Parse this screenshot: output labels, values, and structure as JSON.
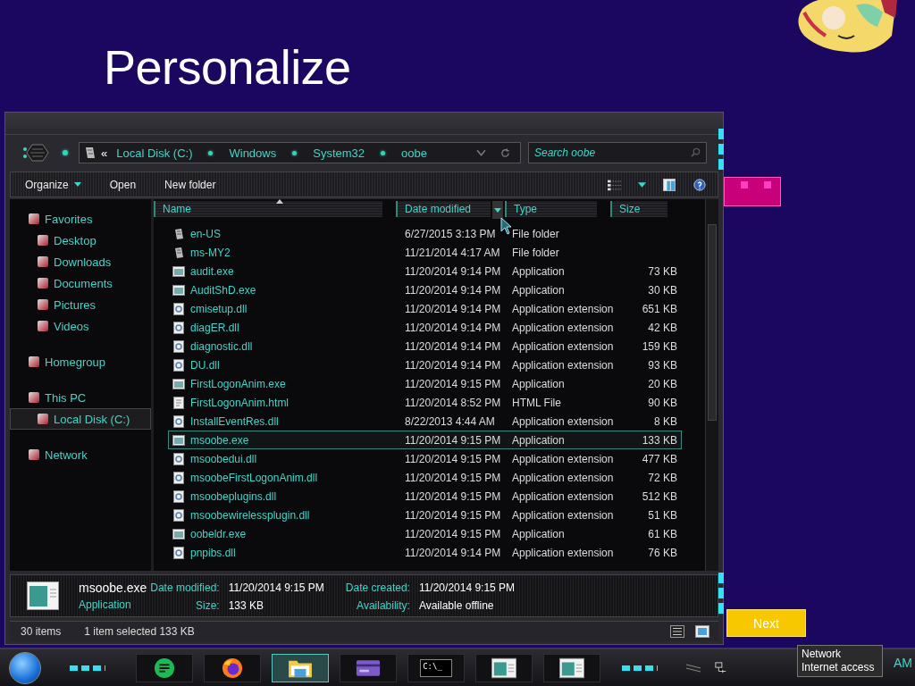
{
  "page": {
    "title": "Personalize"
  },
  "explorer": {
    "address": {
      "prefix": "«",
      "crumbs": [
        "Local Disk (C:)",
        "Windows",
        "System32",
        "oobe"
      ]
    },
    "search": {
      "placeholder": "Search oobe"
    },
    "toolbar": [
      {
        "label": "Organize",
        "kind": "menu"
      },
      {
        "label": "Open",
        "kind": "plain"
      },
      {
        "label": "New folder",
        "kind": "plain"
      }
    ],
    "sidebar": {
      "items": [
        {
          "label": "Favorites",
          "selected": false,
          "children": [
            {
              "label": "Desktop",
              "selected": false
            },
            {
              "label": "Downloads",
              "selected": false
            },
            {
              "label": "Documents",
              "selected": false
            },
            {
              "label": "Pictures",
              "selected": false
            },
            {
              "label": "Videos",
              "selected": false
            }
          ]
        },
        {
          "label": "Homegroup",
          "selected": false
        },
        {
          "label": "This PC",
          "selected": false,
          "children": [
            {
              "label": "Local Disk (C:)",
              "selected": true
            }
          ]
        },
        {
          "label": "Network",
          "selected": false
        }
      ]
    },
    "table": {
      "columns": [
        "Name",
        "Date modified",
        "Type",
        "Size"
      ],
      "rows": [
        {
          "kind": "folder",
          "name": "en-US",
          "date": "6/27/2015 3:13 PM",
          "type": "File folder",
          "size": "",
          "selected": false
        },
        {
          "kind": "folder",
          "name": "ms-MY2",
          "date": "11/21/2014 4:17 AM",
          "type": "File folder",
          "size": "",
          "selected": false
        },
        {
          "kind": "app",
          "name": "audit.exe",
          "date": "11/20/2014 9:14 PM",
          "type": "Application",
          "size": "73 KB",
          "selected": false
        },
        {
          "kind": "app",
          "name": "AuditShD.exe",
          "date": "11/20/2014 9:14 PM",
          "type": "Application",
          "size": "30 KB",
          "selected": false
        },
        {
          "kind": "dll",
          "name": "cmisetup.dll",
          "date": "11/20/2014 9:14 PM",
          "type": "Application extension",
          "size": "651 KB",
          "selected": false
        },
        {
          "kind": "dll",
          "name": "diagER.dll",
          "date": "11/20/2014 9:14 PM",
          "type": "Application extension",
          "size": "42 KB",
          "selected": false
        },
        {
          "kind": "dll",
          "name": "diagnostic.dll",
          "date": "11/20/2014 9:14 PM",
          "type": "Application extension",
          "size": "159 KB",
          "selected": false
        },
        {
          "kind": "dll",
          "name": "DU.dll",
          "date": "11/20/2014 9:14 PM",
          "type": "Application extension",
          "size": "93 KB",
          "selected": false
        },
        {
          "kind": "app",
          "name": "FirstLogonAnim.exe",
          "date": "11/20/2014 9:15 PM",
          "type": "Application",
          "size": "20 KB",
          "selected": false
        },
        {
          "kind": "html",
          "name": "FirstLogonAnim.html",
          "date": "11/20/2014 8:52 PM",
          "type": "HTML File",
          "size": "90 KB",
          "selected": false
        },
        {
          "kind": "dll",
          "name": "InstallEventRes.dll",
          "date": "8/22/2013 4:44 AM",
          "type": "Application extension",
          "size": "8 KB",
          "selected": false
        },
        {
          "kind": "app",
          "name": "msoobe.exe",
          "date": "11/20/2014 9:15 PM",
          "type": "Application",
          "size": "133 KB",
          "selected": true
        },
        {
          "kind": "dll",
          "name": "msoobedui.dll",
          "date": "11/20/2014 9:15 PM",
          "type": "Application extension",
          "size": "477 KB",
          "selected": false
        },
        {
          "kind": "dll",
          "name": "msoobeFirstLogonAnim.dll",
          "date": "11/20/2014 9:15 PM",
          "type": "Application extension",
          "size": "72 KB",
          "selected": false
        },
        {
          "kind": "dll",
          "name": "msoobeplugins.dll",
          "date": "11/20/2014 9:15 PM",
          "type": "Application extension",
          "size": "512 KB",
          "selected": false
        },
        {
          "kind": "dll",
          "name": "msoobewirelessplugin.dll",
          "date": "11/20/2014 9:15 PM",
          "type": "Application extension",
          "size": "51 KB",
          "selected": false
        },
        {
          "kind": "app",
          "name": "oobeldr.exe",
          "date": "11/20/2014 9:15 PM",
          "type": "Application",
          "size": "61 KB",
          "selected": false
        },
        {
          "kind": "dll",
          "name": "pnpibs.dll",
          "date": "11/20/2014 9:14 PM",
          "type": "Application extension",
          "size": "76 KB",
          "selected": false
        }
      ]
    },
    "details": {
      "name": "msoobe.exe",
      "type": "Application",
      "fields": [
        {
          "label": "Date modified:",
          "value": "11/20/2014 9:15 PM"
        },
        {
          "label": "Date created:",
          "value": "11/20/2014 9:15 PM"
        },
        {
          "label": "Size:",
          "value": "133 KB"
        },
        {
          "label": "Availability:",
          "value": "Available offline"
        }
      ]
    },
    "status_bar": {
      "count": "30 items",
      "selection": "1 item selected  133 KB"
    }
  },
  "next_button": {
    "label": "Next"
  },
  "taskbar": {
    "items": [
      {
        "kind": "notes",
        "selected": false
      },
      {
        "kind": "browser",
        "selected": false
      },
      {
        "kind": "explorer",
        "selected": true
      },
      {
        "kind": "card",
        "selected": false
      },
      {
        "kind": "console",
        "label": "C:\\_",
        "selected": false
      },
      {
        "kind": "window",
        "selected": false
      },
      {
        "kind": "window",
        "selected": false
      }
    ],
    "clock": {
      "time": "AM"
    },
    "tooltip": {
      "title": "Network",
      "text": "Internet access"
    }
  }
}
